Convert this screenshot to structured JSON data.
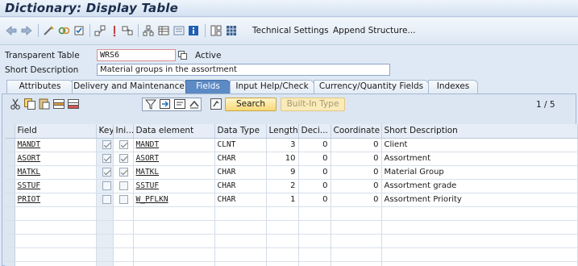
{
  "window": {
    "title": "Dictionary: Display Table"
  },
  "toolbar": {
    "icons": [
      "back-arrow-icon",
      "forward-arrow-icon",
      "other-object-icon",
      "display-change-icon",
      "activate-icon",
      "where-used-icon",
      "object-list-icon",
      "navigation-window-icon",
      "hierarchy-icon",
      "layout-icon",
      "display-object-list-icon",
      "info-icon",
      "graphics-icon",
      "table-contents-icon"
    ],
    "technical_settings": "Technical Settings",
    "append_structure": "Append Structure..."
  },
  "header": {
    "table_type_label": "Transparent Table",
    "table_name": "WRS6",
    "status": "Active",
    "short_desc_label": "Short Description",
    "short_desc_value": "Material groups in the assortment"
  },
  "tabs": [
    {
      "label": "Attributes",
      "active": false
    },
    {
      "label": "Delivery and Maintenance",
      "active": false
    },
    {
      "label": "Fields",
      "active": true
    },
    {
      "label": "Input Help/Check",
      "active": false
    },
    {
      "label": "Currency/Quantity Fields",
      "active": false
    },
    {
      "label": "Indexes",
      "active": false
    }
  ],
  "grid_toolbar": {
    "search": "Search",
    "built_in_type": "Built-In Type",
    "pager": "1 / 5"
  },
  "columns": [
    "Field",
    "Key",
    "Ini...",
    "Data element",
    "Data Type",
    "Length",
    "Deci...",
    "Coordinate",
    "Short Description"
  ],
  "rows": [
    {
      "field": "MANDT",
      "key": true,
      "init": true,
      "element": "MANDT",
      "type": "CLNT",
      "length": "3",
      "decimals": "0",
      "coordinate": "0",
      "desc": "Client"
    },
    {
      "field": "ASORT",
      "key": true,
      "init": true,
      "element": "ASORT",
      "type": "CHAR",
      "length": "10",
      "decimals": "0",
      "coordinate": "0",
      "desc": "Assortment"
    },
    {
      "field": "MATKL",
      "key": true,
      "init": true,
      "element": "MATKL",
      "type": "CHAR",
      "length": "9",
      "decimals": "0",
      "coordinate": "0",
      "desc": "Material Group"
    },
    {
      "field": "SSTUF",
      "key": false,
      "init": false,
      "element": "SSTUF",
      "type": "CHAR",
      "length": "2",
      "decimals": "0",
      "coordinate": "0",
      "desc": "Assortment grade"
    },
    {
      "field": "PRIOT",
      "key": false,
      "init": false,
      "element": "W_PFLKN",
      "type": "CHAR",
      "length": "1",
      "decimals": "0",
      "coordinate": "0",
      "desc": "Assortment Priority"
    }
  ],
  "empty_rows": 5
}
